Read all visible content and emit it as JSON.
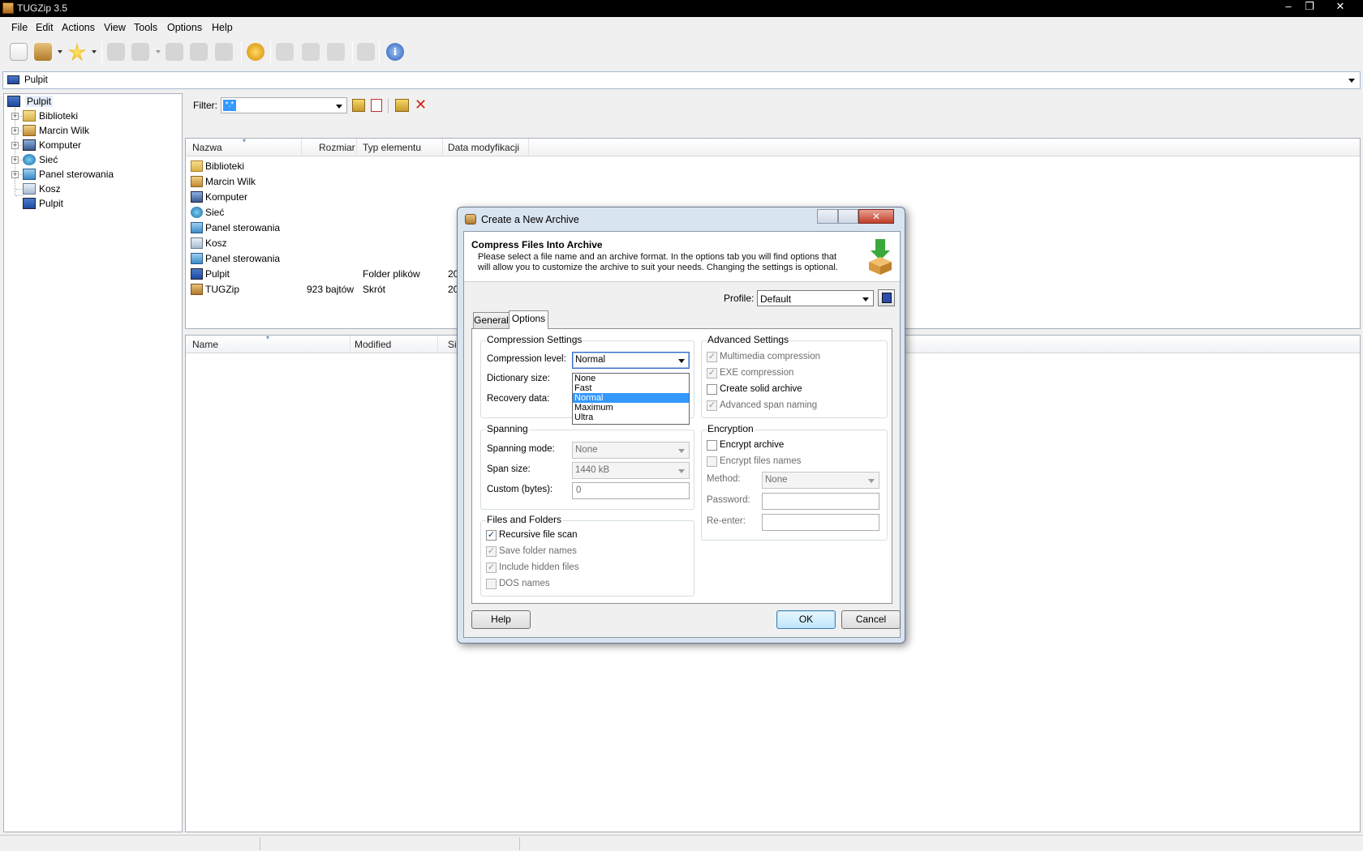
{
  "window": {
    "title": "TUGZip 3.5"
  },
  "menu": [
    "File",
    "Edit",
    "Actions",
    "View",
    "Tools",
    "Options",
    "Help"
  ],
  "address": {
    "value": "Pulpit"
  },
  "tree": {
    "root": "Pulpit",
    "items": [
      "Biblioteki",
      "Marcin Wilk",
      "Komputer",
      "Sieć",
      "Panel sterowania",
      "Kosz",
      "Pulpit"
    ]
  },
  "filter": {
    "label": "Filter:",
    "value": "*.*"
  },
  "file_list": {
    "columns": [
      "Nazwa",
      "Rozmiar",
      "Typ elementu",
      "Data modyfikacji"
    ],
    "rows": [
      {
        "name": "Biblioteki",
        "size": "",
        "type": "",
        "date": ""
      },
      {
        "name": "Marcin Wilk",
        "size": "",
        "type": "",
        "date": ""
      },
      {
        "name": "Komputer",
        "size": "",
        "type": "",
        "date": ""
      },
      {
        "name": "Sieć",
        "size": "",
        "type": "",
        "date": ""
      },
      {
        "name": "Panel sterowania",
        "size": "",
        "type": "",
        "date": ""
      },
      {
        "name": "Kosz",
        "size": "",
        "type": "",
        "date": ""
      },
      {
        "name": "Panel sterowania",
        "size": "",
        "type": "",
        "date": ""
      },
      {
        "name": "Pulpit",
        "size": "",
        "type": "Folder plików",
        "date": "20"
      },
      {
        "name": "TUGZip",
        "size": "923 bajtów",
        "type": "Skrót",
        "date": "20"
      }
    ]
  },
  "archive_list": {
    "columns": [
      "Name",
      "Modified",
      "Si"
    ]
  },
  "dialog": {
    "title": "Create a New Archive",
    "header_title": "Compress Files Into Archive",
    "header_text": "Please select a file name and an archive format. In the options tab you will find options that will allow you to customize the archive to suit your needs. Changing the settings is optional.",
    "profile_label": "Profile:",
    "profile_value": "Default",
    "tabs": [
      "General",
      "Options"
    ],
    "compression": {
      "title": "Compression Settings",
      "level_label": "Compression level:",
      "level_value": "Normal",
      "dictionary_label": "Dictionary size:",
      "recovery_label": "Recovery data:",
      "options": [
        "None",
        "Fast",
        "Normal",
        "Maximum",
        "Ultra"
      ]
    },
    "advanced": {
      "title": "Advanced Settings",
      "multimedia": "Multimedia compression",
      "exe": "EXE compression",
      "solid": "Create solid archive",
      "span_naming": "Advanced span naming"
    },
    "spanning": {
      "title": "Spanning",
      "mode_label": "Spanning mode:",
      "mode_value": "None",
      "size_label": "Span size:",
      "size_value": "1440 kB",
      "custom_label": "Custom (bytes):",
      "custom_value": "0"
    },
    "encryption": {
      "title": "Encryption",
      "encrypt_archive": "Encrypt archive",
      "encrypt_names": "Encrypt files names",
      "method_label": "Method:",
      "method_value": "None",
      "password_label": "Password:",
      "reenter_label": "Re-enter:"
    },
    "files": {
      "title": "Files and Folders",
      "recursive": "Recursive file scan",
      "save_folders": "Save folder names",
      "hidden": "Include hidden files",
      "dos": "DOS names"
    },
    "buttons": {
      "help": "Help",
      "ok": "OK",
      "cancel": "Cancel"
    }
  }
}
